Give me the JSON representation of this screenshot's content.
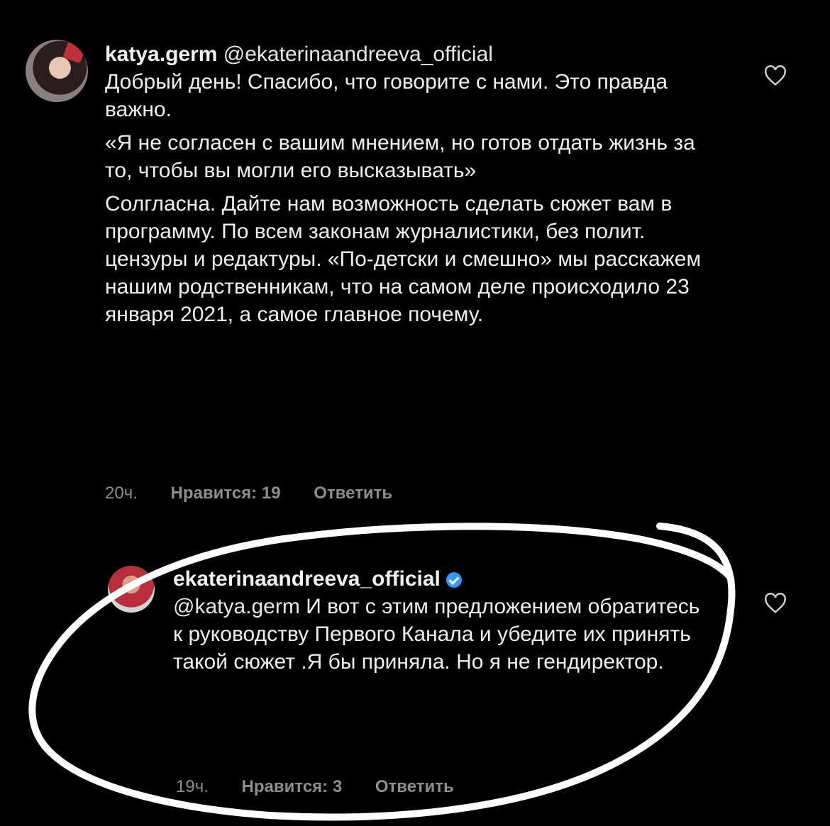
{
  "comments": [
    {
      "username": "katya.germ",
      "mention": "@ekaterinaandreeva_official",
      "paragraphs": [
        "Добрый день! Спасибо, что говорите с нами. Это правда важно.",
        "«Я не согласен с вашим мнением, но готов отдать жизнь за то, чтобы вы могли его высказывать»",
        "Солгласна. Дайте нам возможность сделать сюжет вам в программу. По всем законам журналистики, без полит. цензуры и редактуры. «По-детски и смешно» мы расскажем нашим родственникам, что на самом деле происходило 23 января 2021, а самое главное почему."
      ],
      "time": "20ч.",
      "likes": "Нравится: 19",
      "reply": "Ответить",
      "like_icon": "heart-outline-icon"
    },
    {
      "username": "ekaterinaandreeva_official",
      "verified_icon": "verified-badge-icon",
      "mention": "@katya.germ",
      "paragraphs": [
        "И вот с этим предложением обратитесь к руководству Первого Канала и убедите их принять такой сюжет .Я бы приняла. Но я не гендиректор."
      ],
      "time": "19ч.",
      "likes": "Нравится: 3",
      "reply": "Ответить",
      "like_icon": "heart-outline-icon"
    }
  ],
  "colors": {
    "background": "#000000",
    "text": "#f2f2f2",
    "secondary": "#8e8e8e",
    "verified": "#3897f0",
    "annotation": "#ffffff"
  }
}
